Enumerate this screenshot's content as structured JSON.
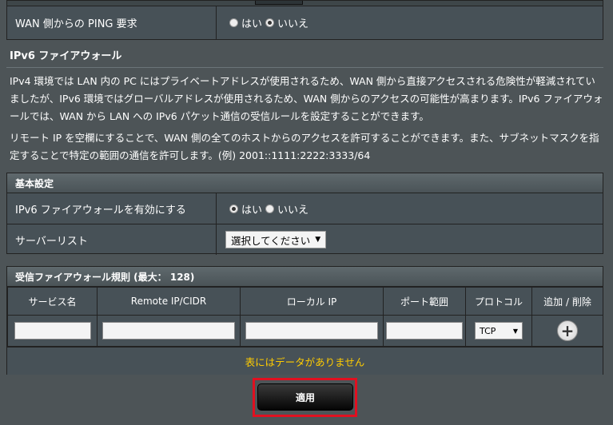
{
  "wan_ping": {
    "label": "WAN 側からの PING 要求",
    "options": [
      "はい",
      "いいえ"
    ],
    "selected": "いいえ"
  },
  "ipv6_firewall": {
    "title": "IPv6 ファイアウォール",
    "desc1": "IPv4 環境では LAN 内の PC にはプライベートアドレスが使用されるため、WAN 側から直接アクセスされる危険性が軽減されていましたが、IPv6 環境ではグローバルアドレスが使用されるため、WAN 側からのアクセスの可能性が高まります。IPv6 ファイアウォールでは、WAN から LAN への IPv6 パケット通信の受信ルールを設定することができます。",
    "desc2": "リモート IP を空欄にすることで、WAN 側の全てのホストからのアクセスを許可することができます。また、サブネットマスクを指定することで特定の範囲の通信を許可します。(例) 2001::1111:2222:3333/64"
  },
  "basic": {
    "header": "基本設定",
    "enable_label": "IPv6 ファイアウォールを有効にする",
    "enable_options": [
      "はい",
      "いいえ"
    ],
    "enable_selected": "はい",
    "server_list_label": "サーバーリスト",
    "server_list_value": "選択してください"
  },
  "rules": {
    "header": "受信ファイアウォール規則 (最大： 128)",
    "columns": [
      "サービス名",
      "Remote IP/CIDR",
      "ローカル IP",
      "ポート範囲",
      "プロトコル",
      "追加 / 削除"
    ],
    "protocol_value": "TCP",
    "empty_text": "表にはデータがありません"
  },
  "apply_label": "適用"
}
